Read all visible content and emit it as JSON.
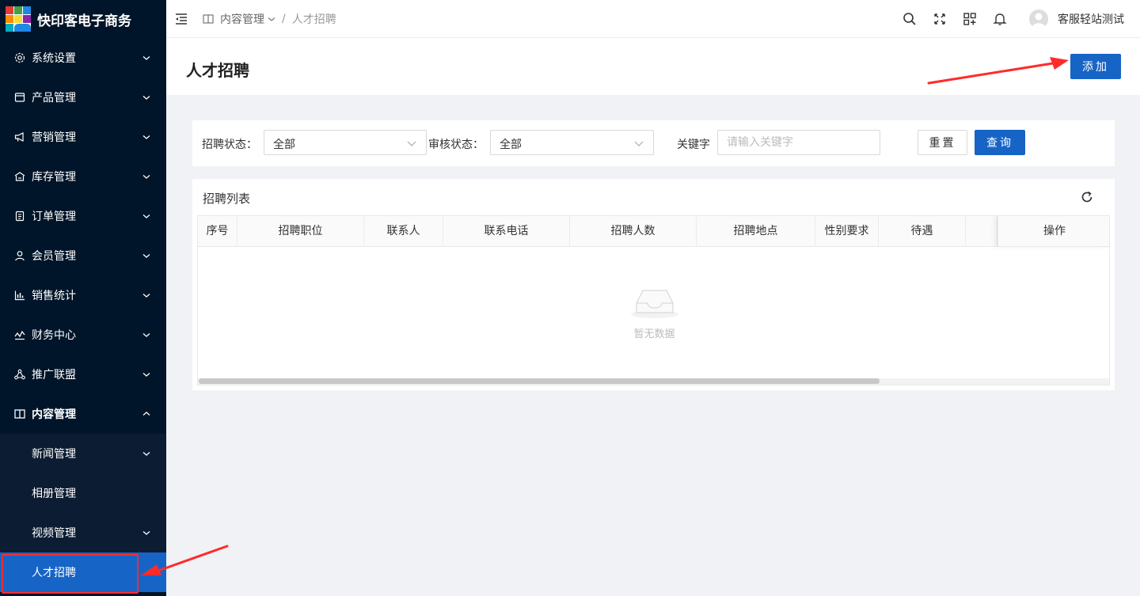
{
  "app": {
    "title": "快印客电子商务"
  },
  "sidebar": {
    "items": [
      {
        "label": "系统设置",
        "icon": "gear-icon"
      },
      {
        "label": "产品管理",
        "icon": "box-icon"
      },
      {
        "label": "营销管理",
        "icon": "megaphone-icon"
      },
      {
        "label": "库存管理",
        "icon": "warehouse-icon"
      },
      {
        "label": "订单管理",
        "icon": "order-icon"
      },
      {
        "label": "会员管理",
        "icon": "user-icon"
      },
      {
        "label": "销售统计",
        "icon": "bar-chart-icon"
      },
      {
        "label": "财务中心",
        "icon": "trend-icon"
      },
      {
        "label": "推广联盟",
        "icon": "network-icon"
      },
      {
        "label": "内容管理",
        "icon": "book-icon"
      }
    ],
    "submenu": [
      {
        "label": "新闻管理"
      },
      {
        "label": "相册管理"
      },
      {
        "label": "视频管理"
      },
      {
        "label": "人才招聘"
      }
    ],
    "active_color": "#1764c7"
  },
  "header": {
    "breadcrumb_parent": "内容管理",
    "breadcrumb_sep": "/",
    "breadcrumb_current": "人才招聘",
    "username": "客服轻站测试"
  },
  "page": {
    "title": "人才招聘",
    "add_label": "添加"
  },
  "filters": {
    "recruit_status_label": "招聘状态：",
    "recruit_status_value": "全部",
    "audit_status_label": "审核状态：",
    "audit_status_value": "全部",
    "keyword_label": "关键字",
    "keyword_placeholder": "请输入关键字",
    "reset_label": "重置",
    "query_label": "查询"
  },
  "table": {
    "title": "招聘列表",
    "columns": [
      "序号",
      "招聘职位",
      "联系人",
      "联系电话",
      "招聘人数",
      "招聘地点",
      "性别要求",
      "待遇",
      "",
      "操作"
    ],
    "empty_text": "暂无数据"
  },
  "colors": {
    "primary": "#1764c7",
    "sidebar": "#001529",
    "annotation": "#ff2b2b"
  }
}
